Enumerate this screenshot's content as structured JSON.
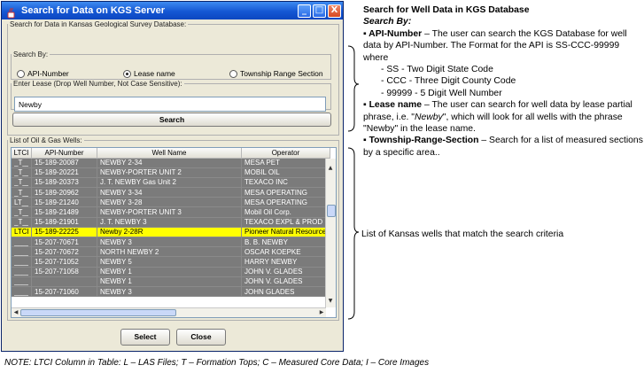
{
  "window": {
    "title": "Search for Data on KGS Server",
    "controls": [
      "_",
      "□",
      "X"
    ]
  },
  "search_panel": {
    "legend": "Search for Data in Kansas Geological Survey Database:",
    "search_by_legend": "Search By:",
    "options": [
      {
        "label": "API-Number",
        "selected": false
      },
      {
        "label": "Lease name",
        "selected": true
      },
      {
        "label": "Township Range Section",
        "selected": false
      }
    ],
    "lease_legend": "Enter Lease (Drop Well Number, Not Case Sensitive):",
    "lease_value": "Newby",
    "search_button": "Search"
  },
  "list_panel": {
    "legend": "List of Oil & Gas Wells:",
    "columns": [
      "LTCI",
      "API-Number",
      "Well Name",
      "Operator"
    ],
    "rows": [
      [
        "_T__",
        "15-189-20087",
        "NEWBY 2-34",
        "MESA PET"
      ],
      [
        "_T__",
        "15-189-20221",
        "NEWBY-PORTER UNIT 2",
        "MOBIL OIL"
      ],
      [
        "_T__",
        "15-189-20373",
        "J. T. NEWBY Gas Unit 2",
        "TEXACO INC"
      ],
      [
        "_T__",
        "15-189-20962",
        "NEWBY 3-34",
        "MESA OPERATING"
      ],
      [
        "LT__",
        "15-189-21240",
        "NEWBY 3-28",
        "MESA OPERATING"
      ],
      [
        "_T__",
        "15-189-21489",
        "NEWBY-PORTER UNIT 3",
        "Mobil Oil Corp."
      ],
      [
        "_T__",
        "15-189-21901",
        "J. T. NEWBY 3",
        "TEXACO EXPL & PROD"
      ],
      [
        "LTCI",
        "15-189-22225",
        "Newby 2-28R",
        "Pioneer Natural Resources"
      ],
      [
        "____",
        "15-207-70671",
        "NEWBY 3",
        "B. B. NEWBY"
      ],
      [
        "____",
        "15-207-70672",
        "NORTH NEWBY 2",
        "OSCAR KOEPKE"
      ],
      [
        "____",
        "15-207-71052",
        "NEWBY 5",
        "HARRY NEWBY"
      ],
      [
        "____",
        "15-207-71058",
        "NEWBY 1",
        "JOHN V. GLADES"
      ],
      [
        "____",
        "",
        "NEWBY 1",
        "JOHN V. GLADES"
      ],
      [
        "____",
        "15-207-71060",
        "NEWBY 3",
        "JOHN GLADES"
      ]
    ],
    "selected_row": 7
  },
  "buttons": {
    "select": "Select",
    "close": "Close"
  },
  "annotations": {
    "heading": "Search for Well Data in KGS Database",
    "subheading": "Search By:",
    "api_term": "▪ API-Number",
    "api_text": " – The user can search the KGS Database for well data by API-Number.  The Format for the API is SS-CCC-99999 where",
    "api_items": [
      "- SS -  Two Digit State Code",
      "- CCC - Three Digit County Code",
      "- 99999 - 5 Digit Well Number"
    ],
    "lease_term": "▪ Lease name",
    "lease_text_1": " – The user can search for well data by lease partial phrase, i.e. \"",
    "lease_example": "Newby",
    "lease_text_2": "\", which will look for all wells with the phrase \"Newby\" in the lease name.",
    "trs_term": "▪ Township-Range-Section",
    "trs_text": " – Search for a list of measured sections by a specific area..",
    "list_note": "List of Kansas wells that match the search criteria",
    "footnote": "NOTE: LTCI Column in Table:  L – LAS Files;  T – Formation Tops;  C – Measured Core Data;  I – Core Images"
  }
}
